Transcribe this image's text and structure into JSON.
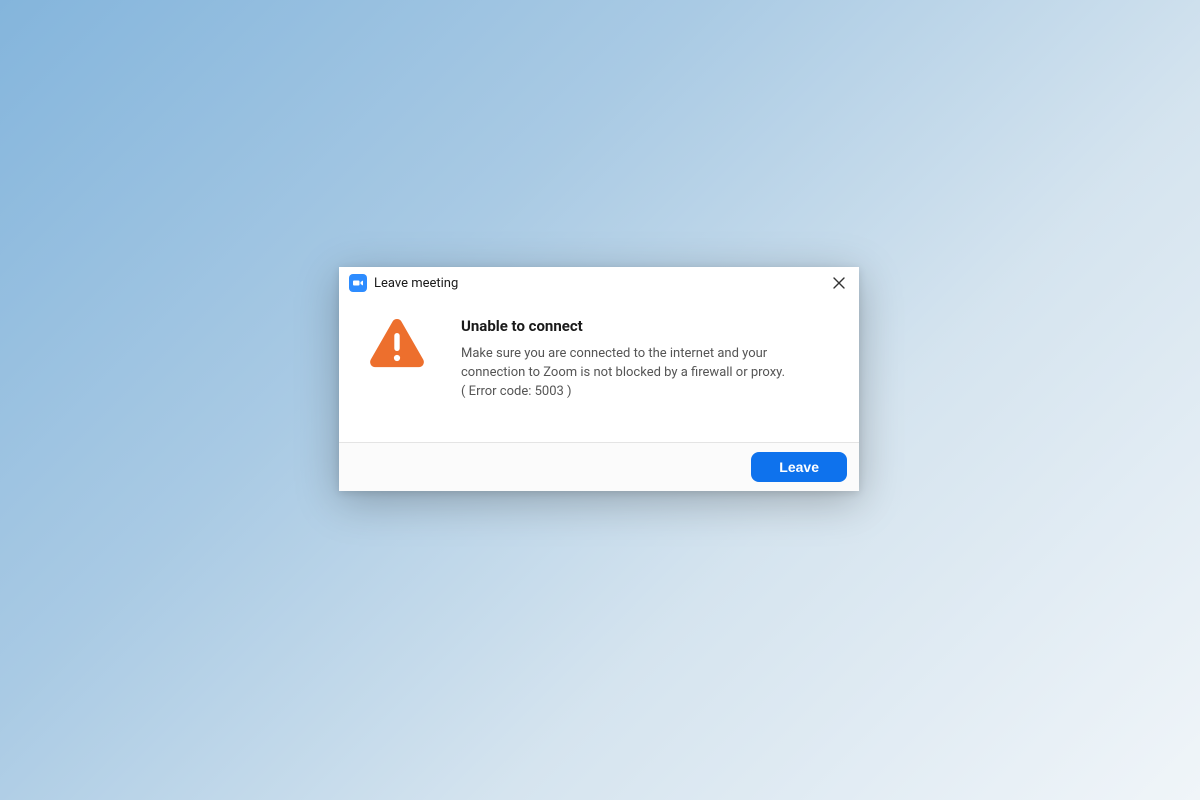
{
  "dialog": {
    "title": "Leave meeting",
    "heading": "Unable to connect",
    "body": "Make sure you are connected to the internet and your connection to Zoom is not blocked by a firewall or proxy.",
    "error_code": "( Error code: 5003 )",
    "leave_button": "Leave"
  }
}
